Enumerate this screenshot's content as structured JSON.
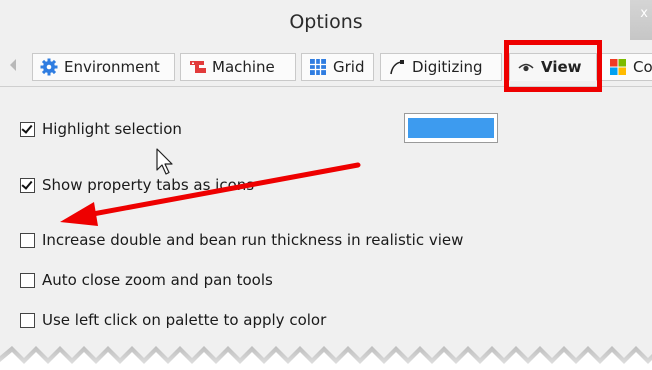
{
  "window": {
    "title": "Options"
  },
  "tabs": [
    {
      "label": "Environment",
      "icon": "gear-icon"
    },
    {
      "label": "Machine",
      "icon": "machine-icon"
    },
    {
      "label": "Grid",
      "icon": "grid-icon"
    },
    {
      "label": "Digitizing",
      "icon": "digitizing-pen-icon"
    },
    {
      "label": "View",
      "icon": "eye-icon",
      "active": true
    },
    {
      "label": "Co",
      "icon": "color-squares-icon"
    }
  ],
  "options": [
    {
      "label": "Highlight selection",
      "checked": true
    },
    {
      "label": "Show property tabs as icons",
      "checked": true
    },
    {
      "label": "Increase double and bean run thickness in realistic view",
      "checked": false
    },
    {
      "label": "Auto close zoom and pan tools",
      "checked": false
    },
    {
      "label": "Use left click on palette to apply color",
      "checked": false
    }
  ],
  "highlight_color": "#3d9bef",
  "annotation_color": "#ee0000"
}
